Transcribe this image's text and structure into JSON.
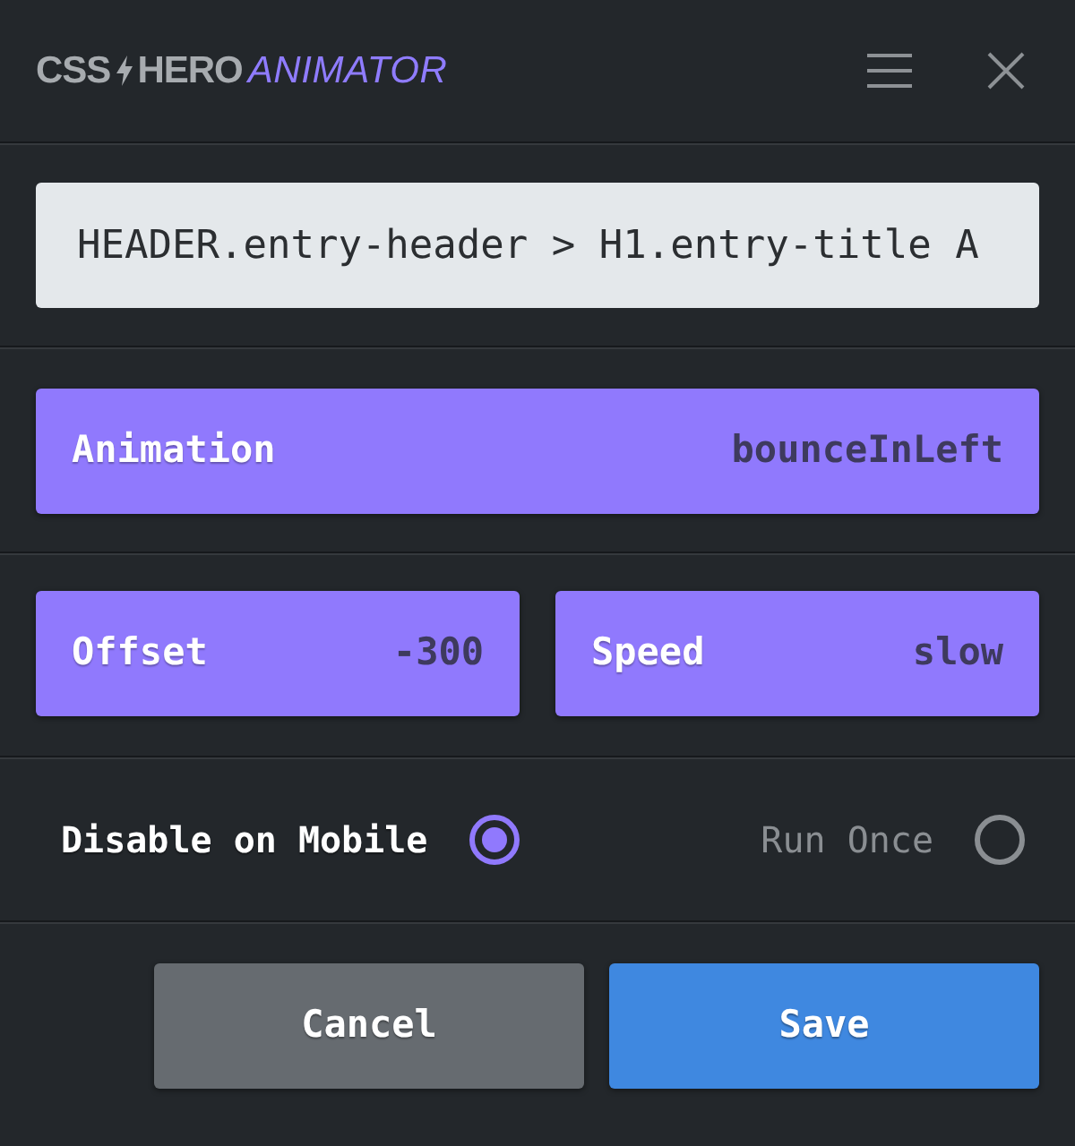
{
  "header": {
    "logo": {
      "brand_start": "CSS",
      "brand_end": "HERO",
      "product": "ANIMATOR"
    }
  },
  "selector": {
    "value": "HEADER.entry-header > H1.entry-title A"
  },
  "animation": {
    "label": "Animation",
    "value": "bounceInLeft"
  },
  "timing": [
    {
      "label": "Offset",
      "value": "-300"
    },
    {
      "label": "Speed",
      "value": "slow"
    }
  ],
  "options": [
    {
      "label": "Disable on Mobile",
      "checked": true
    },
    {
      "label": "Run Once",
      "checked": false
    }
  ],
  "buttons": [
    {
      "label": "Cancel",
      "kind": "secondary"
    },
    {
      "label": "Save",
      "kind": "primary"
    }
  ]
}
